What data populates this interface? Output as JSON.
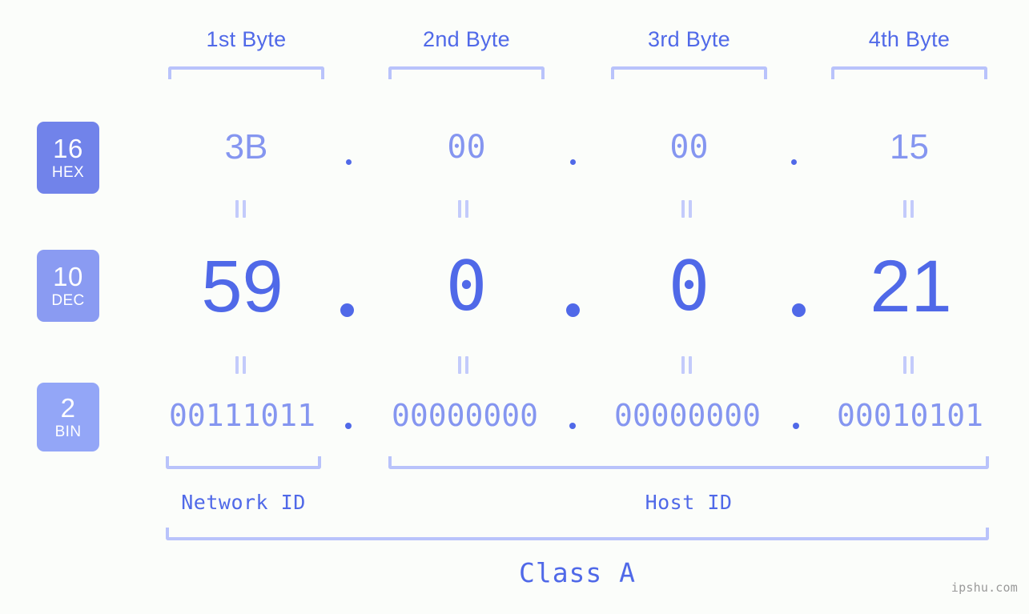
{
  "background_color": "#fbfdfa",
  "accent_color": "#5069e8",
  "accent_light": "#8596f0",
  "bracket_color": "#b9c3fb",
  "byte_headers": [
    {
      "label": "1st Byte"
    },
    {
      "label": "2nd Byte"
    },
    {
      "label": "3rd Byte"
    },
    {
      "label": "4th Byte"
    }
  ],
  "rows": [
    {
      "badge_number": "16",
      "badge_name": "HEX",
      "badge_color": "#7183ea",
      "values": [
        "3B",
        "00",
        "00",
        "15"
      ]
    },
    {
      "badge_number": "10",
      "badge_name": "DEC",
      "badge_color": "#8a9bf2",
      "values": [
        "59",
        "0",
        "0",
        "21"
      ]
    },
    {
      "badge_number": "2",
      "badge_name": "BIN",
      "badge_color": "#93a6f7",
      "values": [
        "00111011",
        "00000000",
        "00000000",
        "00010101"
      ]
    }
  ],
  "separator": ".",
  "equals_symbol": "=",
  "sections": [
    {
      "label": "Network ID"
    },
    {
      "label": "Host ID"
    }
  ],
  "class_label": "Class A",
  "watermark": "ipshu.com",
  "ip_address": {
    "hex": "3B.00.00.15",
    "dec": "59.0.0.21",
    "bin": "00111011.00000000.00000000.00010101"
  }
}
